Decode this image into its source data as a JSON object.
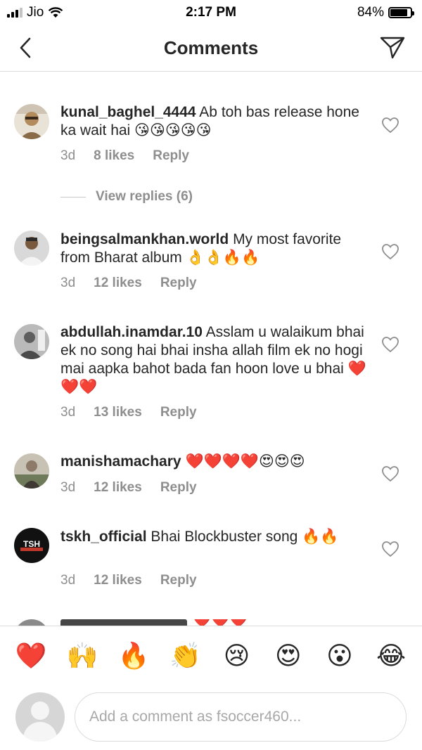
{
  "status_bar": {
    "carrier": "Jio",
    "time": "2:17 PM",
    "battery_percent": "84%",
    "battery_level": 0.84,
    "signal_bars_active": 3,
    "wifi_icon": "wifi-icon"
  },
  "nav": {
    "title": "Comments",
    "back_icon": "chevron-left-icon",
    "send_icon": "send-paper-plane-icon"
  },
  "comments": [
    {
      "username": "kunal_baghel_4444",
      "text": "Ab toh bas release hone ka wait hai 😘😘😘😘😘",
      "time": "3d",
      "likes": "8 likes",
      "reply": "Reply",
      "view_replies": "View replies (6)",
      "avatar_color": "#b38b5d"
    },
    {
      "username": "beingsalmankhan.world",
      "text": "My most favorite from Bharat album 👌👌🔥🔥",
      "time": "3d",
      "likes": "12 likes",
      "reply": "Reply",
      "avatar_color": "#6a6a6a"
    },
    {
      "username": "abdullah.inamdar.10",
      "text": "Asslam u walaikum bhai ek no song hai bhai insha allah film ek no hogi mai aapka bahot bada fan hoon love u bhai ❤️❤️❤️",
      "time": "3d",
      "likes": "13 likes",
      "reply": "Reply",
      "avatar_color": "#7a7a7a"
    },
    {
      "username": "manishamachary",
      "text": "❤️❤️❤️❤️😍😍😍",
      "time": "3d",
      "likes": "12 likes",
      "reply": "Reply",
      "avatar_color": "#8d7a68"
    },
    {
      "username": "tskh_official",
      "text": "Bhai Blockbuster song 🔥🔥",
      "time": "3d",
      "likes": "12 likes",
      "reply": "Reply",
      "avatar_color": "#111111",
      "avatar_text": "TSH"
    }
  ],
  "partial_comment_text": "❤️❤️❤️",
  "emoji_bar": [
    {
      "emoji": "❤️",
      "name": "red-heart-emoji"
    },
    {
      "emoji": "🙌",
      "name": "raising-hands-emoji"
    },
    {
      "emoji": "🔥",
      "name": "fire-emoji"
    },
    {
      "emoji": "👏",
      "name": "clapping-hands-emoji"
    },
    {
      "emoji": "😢",
      "name": "crying-face-emoji"
    },
    {
      "emoji": "😍",
      "name": "heart-eyes-emoji"
    },
    {
      "emoji": "😮",
      "name": "open-mouth-face-emoji"
    },
    {
      "emoji": "😂",
      "name": "tears-of-joy-emoji"
    }
  ],
  "input": {
    "placeholder": "Add a comment as fsoccer460..."
  },
  "colors": {
    "text": "#262626",
    "secondary": "#8e8e8e",
    "divider": "#dbdbdb"
  }
}
